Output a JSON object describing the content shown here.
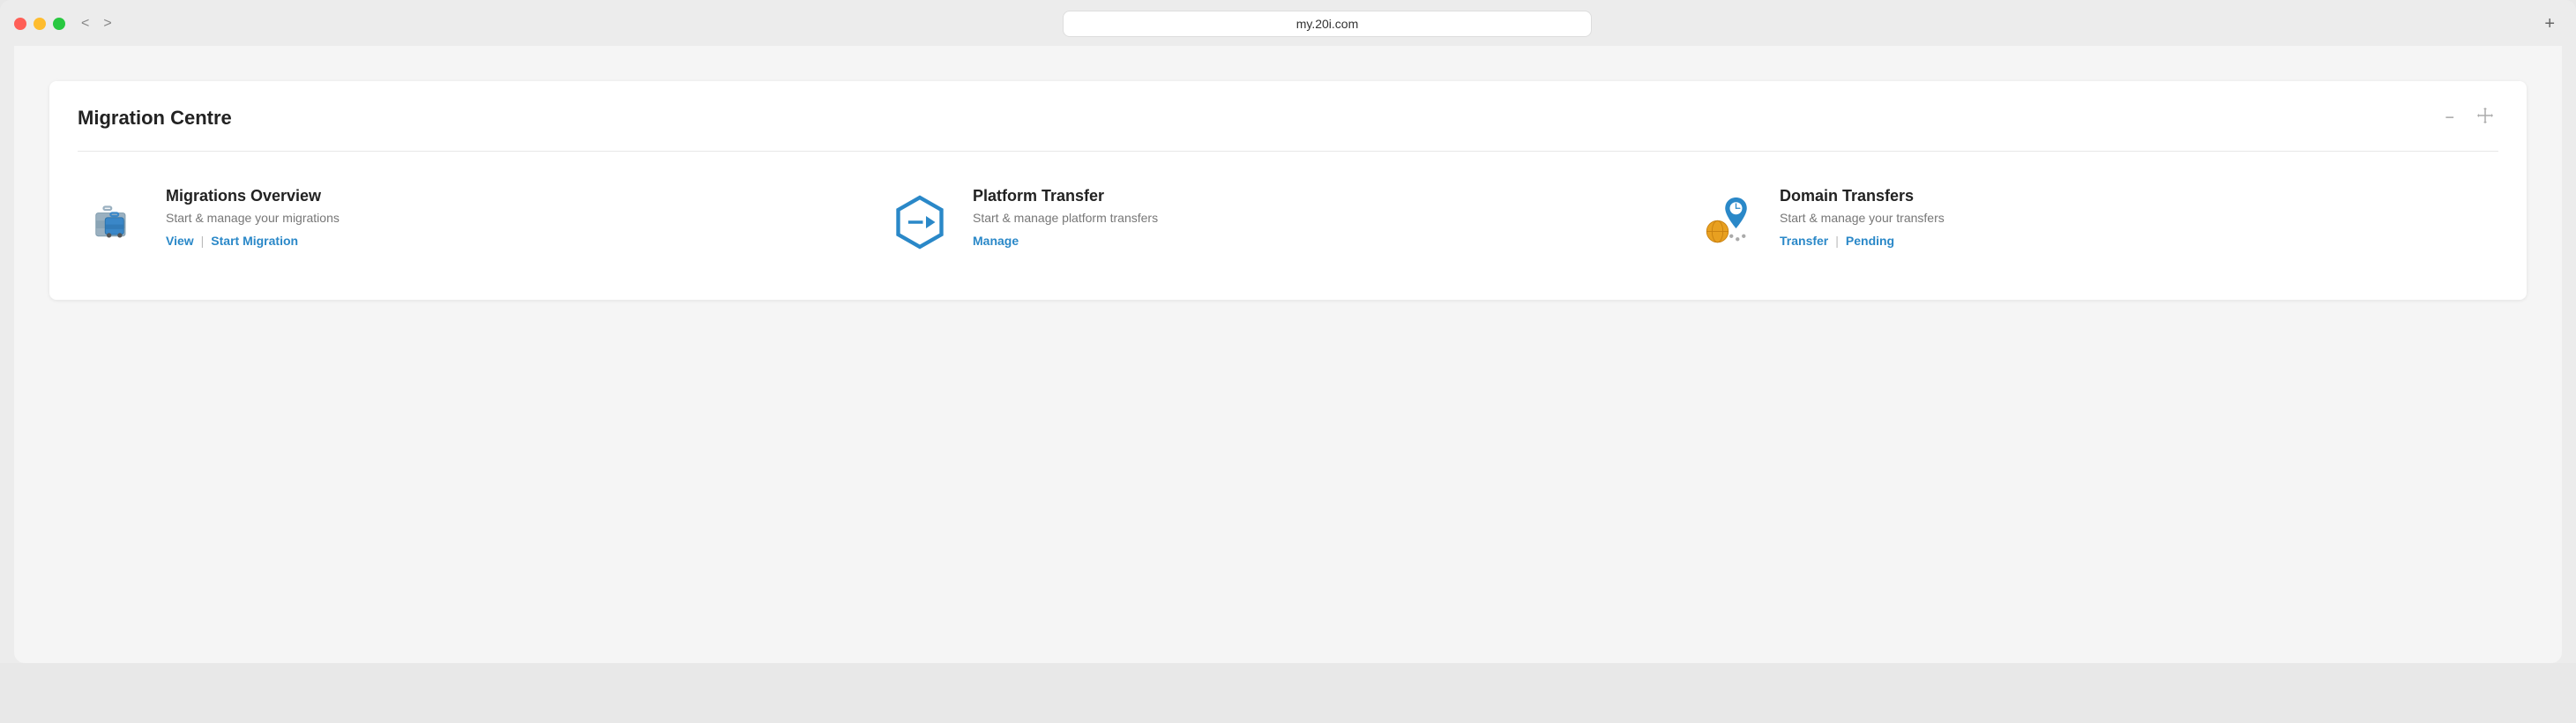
{
  "browser": {
    "url": "my.20i.com",
    "back_label": "<",
    "forward_label": ">",
    "new_tab_label": "+"
  },
  "widget": {
    "title": "Migration Centre",
    "minimize_label": "−",
    "move_label": "⊕",
    "divider": true
  },
  "cards": [
    {
      "id": "migrations-overview",
      "title": "Migrations Overview",
      "description": "Start & manage your migrations",
      "links": [
        {
          "label": "View",
          "id": "view-link"
        },
        {
          "label": "Start Migration",
          "id": "start-migration-link"
        }
      ],
      "icon": "luggage"
    },
    {
      "id": "platform-transfer",
      "title": "Platform Transfer",
      "description": "Start & manage platform transfers",
      "links": [
        {
          "label": "Manage",
          "id": "manage-link"
        }
      ],
      "icon": "platform"
    },
    {
      "id": "domain-transfers",
      "title": "Domain Transfers",
      "description": "Start & manage your transfers",
      "links": [
        {
          "label": "Transfer",
          "id": "transfer-link"
        },
        {
          "label": "Pending",
          "id": "pending-link"
        }
      ],
      "icon": "domain"
    }
  ]
}
